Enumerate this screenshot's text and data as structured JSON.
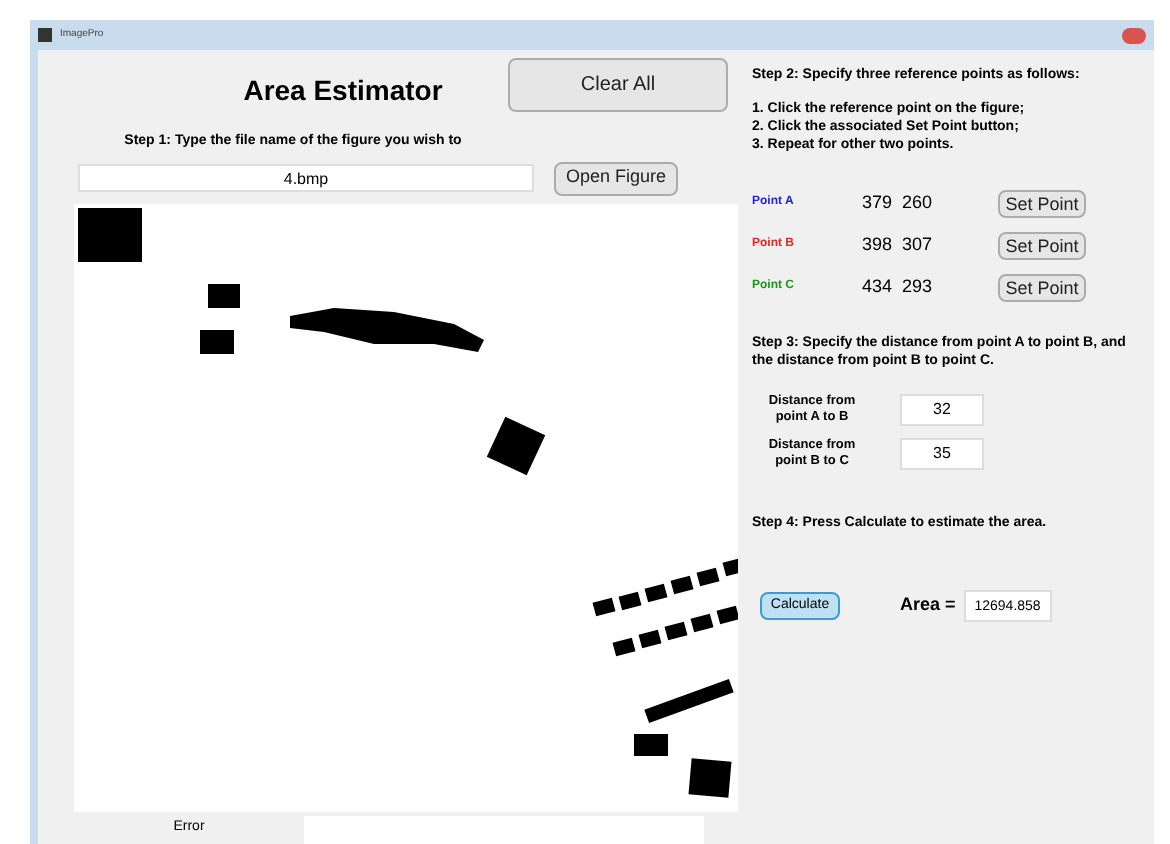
{
  "window": {
    "title": "ImagePro"
  },
  "heading": "Area Estimator",
  "clear_button": "Clear All",
  "step1": {
    "label": "Step 1:  Type the file name of the figure you wish to",
    "value": "4.bmp",
    "button": "Open Figure"
  },
  "step2": {
    "label": "Step 2:  Specify three reference points as follows:",
    "instructions": [
      "1. Click the reference point on the figure;",
      "2. Click the associated Set Point button;",
      "3. Repeat for other two points."
    ]
  },
  "points": [
    {
      "label": "Point A",
      "color": "#2222dd",
      "coords": "379  260",
      "button": "Set Point"
    },
    {
      "label": "Point B",
      "color": "#ee2222",
      "coords": "398  307",
      "button": "Set Point"
    },
    {
      "label": "Point C",
      "color": "#119911",
      "coords": "434  293",
      "button": "Set Point"
    }
  ],
  "step3": {
    "label": "Step 3:  Specify the distance from point A to point B, and the distance from point B to point C.",
    "distances": [
      {
        "label": "Distance from point A to B",
        "value": "32"
      },
      {
        "label": "Distance from point B to C",
        "value": "35"
      }
    ]
  },
  "step4": {
    "label": "Step 4:  Press Calculate to estimate the area.",
    "button": "Calculate",
    "result_label": "Area =",
    "result": "12694.858"
  },
  "error": {
    "label": "Error"
  }
}
